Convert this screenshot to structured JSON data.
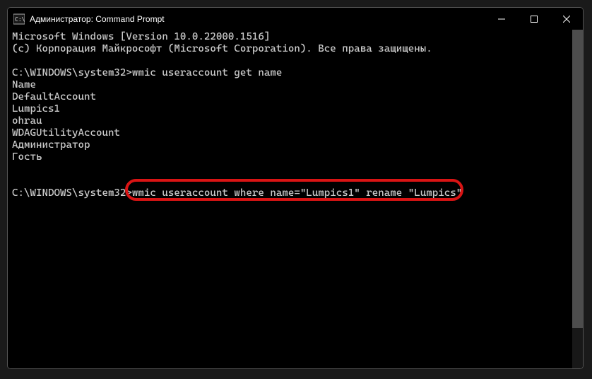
{
  "titlebar": {
    "title": "Администратор: Command Prompt"
  },
  "terminal": {
    "lines": [
      "Microsoft Windows [Version 10.0.22000.1516]",
      "(c) Корпорация Майкрософт (Microsoft Corporation). Все права защищены.",
      "",
      "C:\\WINDOWS\\system32>wmic useraccount get name",
      "Name",
      "DefaultAccount",
      "Lumpics1",
      "ohrau",
      "WDAGUtilityAccount",
      "Администратор",
      "Гость",
      "",
      "",
      "C:\\WINDOWS\\system32>wmic useraccount where name=\"Lumpics1\" rename \"Lumpics\""
    ],
    "highlighted_command": "wmic useraccount where name=\"Lumpics1\" rename \"Lumpics\""
  }
}
